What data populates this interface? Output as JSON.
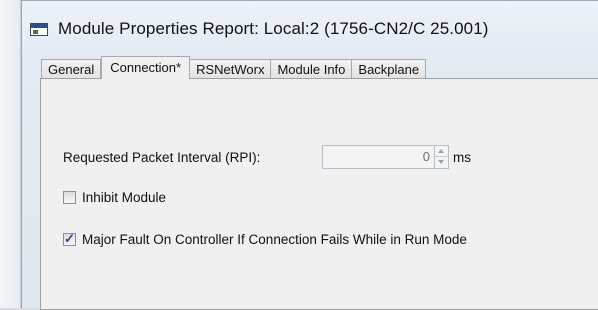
{
  "window": {
    "title": "Module Properties Report: Local:2 (1756-CN2/C 25.001)",
    "icon": "module-properties-icon"
  },
  "tabs": [
    {
      "label": "General",
      "active": false
    },
    {
      "label": "Connection*",
      "active": true
    },
    {
      "label": "RSNetWorx",
      "active": false
    },
    {
      "label": "Module Info",
      "active": false
    },
    {
      "label": "Backplane",
      "active": false
    }
  ],
  "connection": {
    "rpi_label": "Requested Packet Interval (RPI):",
    "rpi_value": "0",
    "rpi_unit": "ms",
    "inhibit_label": "Inhibit Module",
    "inhibit_checked": false,
    "major_fault_label": "Major Fault On Controller If Connection Fails While in Run Mode",
    "major_fault_checked": true
  }
}
